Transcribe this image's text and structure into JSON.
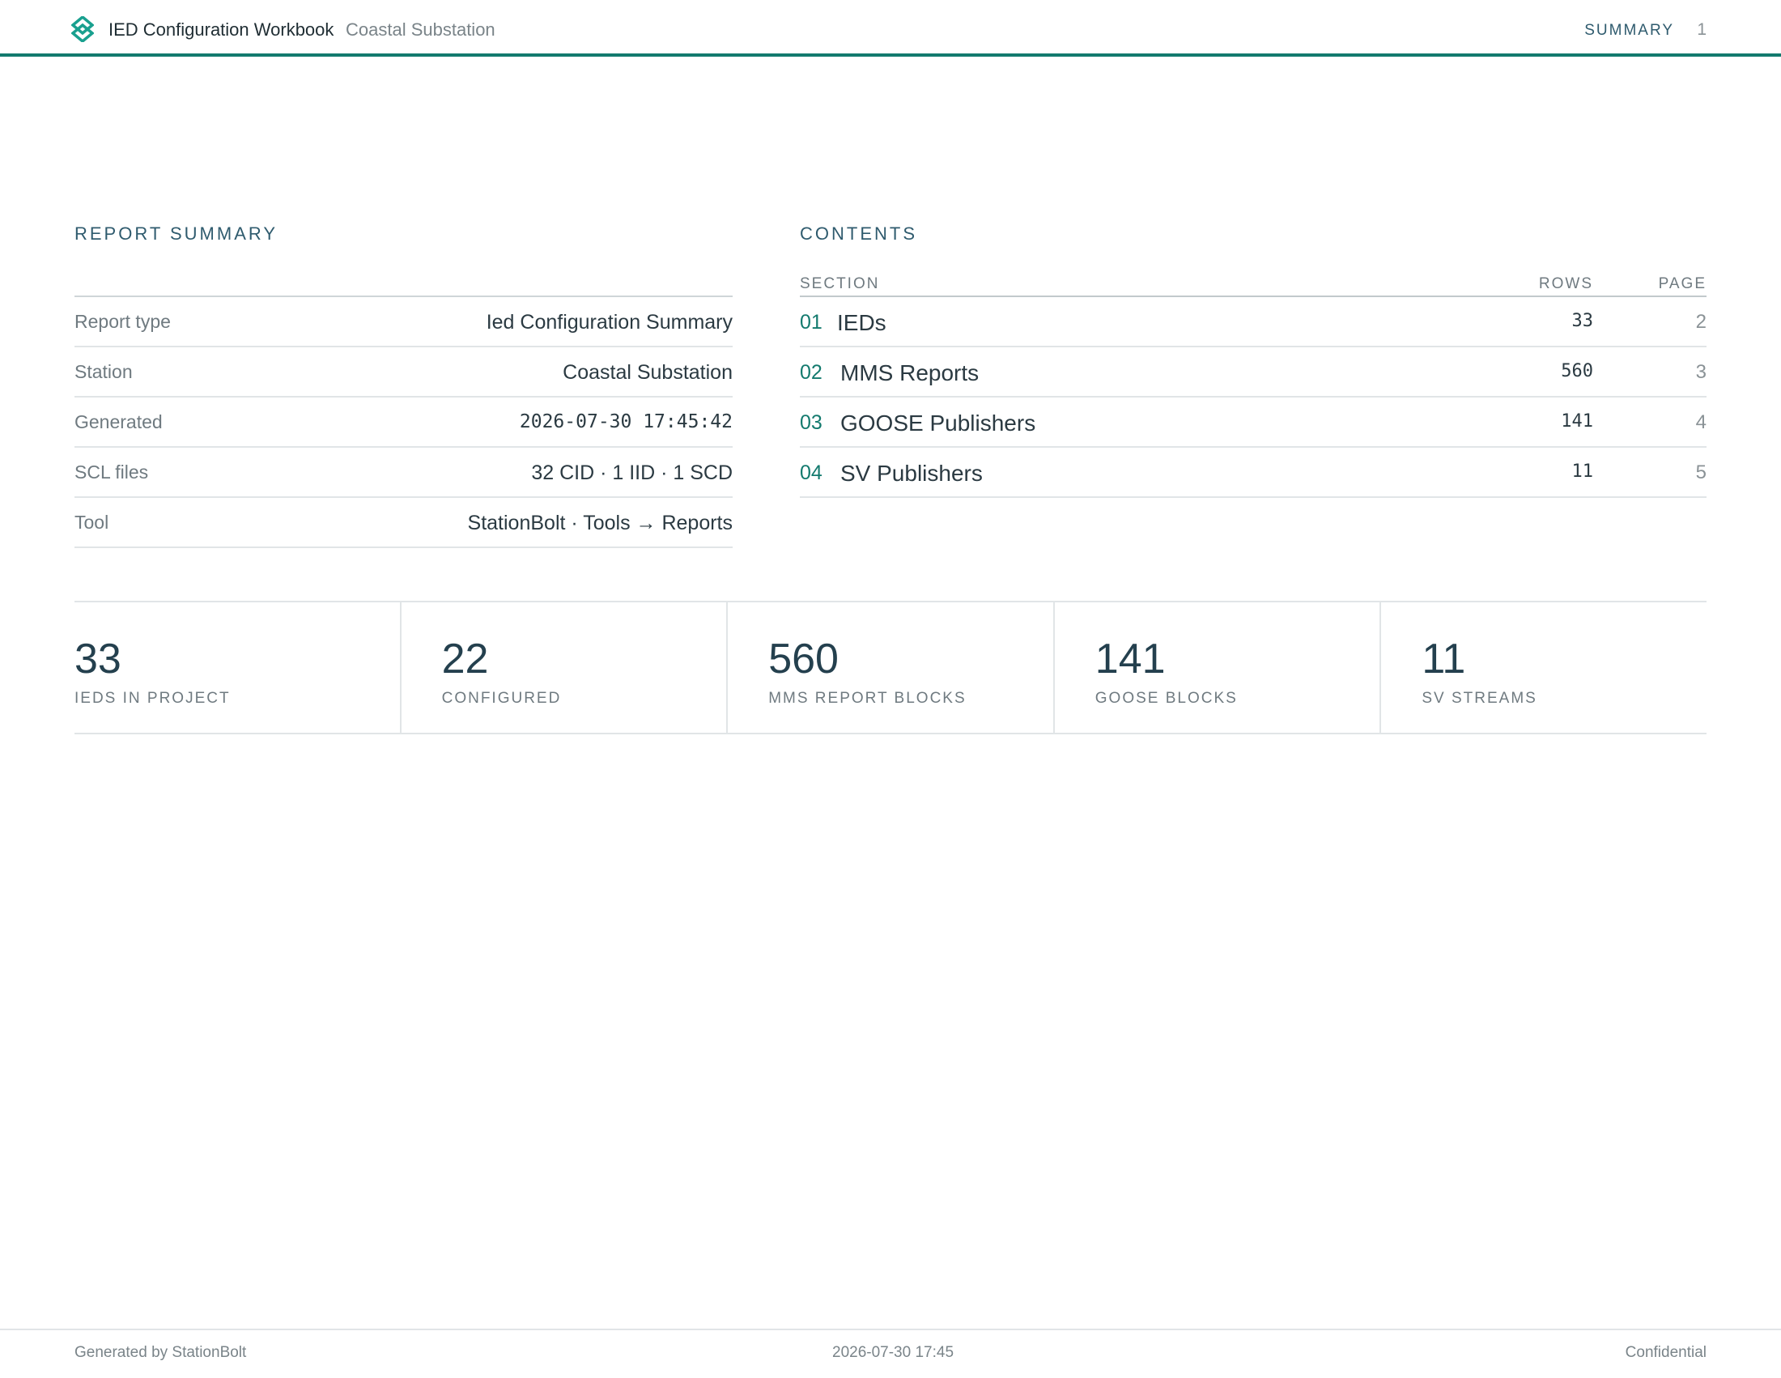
{
  "header": {
    "logo_icon": "diamond-logo-icon",
    "title": "IED Configuration Workbook",
    "subtitle": "Coastal Substation",
    "section_label": "SUMMARY",
    "page_number": "1",
    "accent_color": "#137a6e"
  },
  "report_summary": {
    "heading": "REPORT SUMMARY",
    "rows": [
      {
        "key": "Report type",
        "value": "Ied Configuration Summary"
      },
      {
        "key": "Station",
        "value": "Coastal Substation"
      },
      {
        "key": "Generated",
        "value": "2026-07-30 17:45:42"
      },
      {
        "key": "SCL files",
        "value": "32 CID · 1 IID · 1 SCD"
      },
      {
        "key": "Tool",
        "value": "StationBolt · Tools → Reports"
      }
    ]
  },
  "contents": {
    "heading": "CONTENTS",
    "columns": {
      "section": "SECTION",
      "rows": "ROWS",
      "page": "PAGE"
    },
    "items": [
      {
        "num": "01",
        "name": "IEDs",
        "rows": "33",
        "page": "2"
      },
      {
        "num": "02",
        "name": "MMS Reports",
        "rows": "560",
        "page": "3"
      },
      {
        "num": "03",
        "name": "GOOSE Publishers",
        "rows": "141",
        "page": "4"
      },
      {
        "num": "04",
        "name": "SV Publishers",
        "rows": "11",
        "page": "5"
      }
    ]
  },
  "stats": [
    {
      "value": "33",
      "label": "IEDS IN PROJECT"
    },
    {
      "value": "22",
      "label": "CONFIGURED"
    },
    {
      "value": "560",
      "label": "MMS REPORT BLOCKS"
    },
    {
      "value": "141",
      "label": "GOOSE BLOCKS"
    },
    {
      "value": "11",
      "label": "SV STREAMS"
    }
  ],
  "footer": {
    "left": "Generated by StationBolt",
    "center": "2026-07-30 17:45",
    "right": "Confidential"
  }
}
